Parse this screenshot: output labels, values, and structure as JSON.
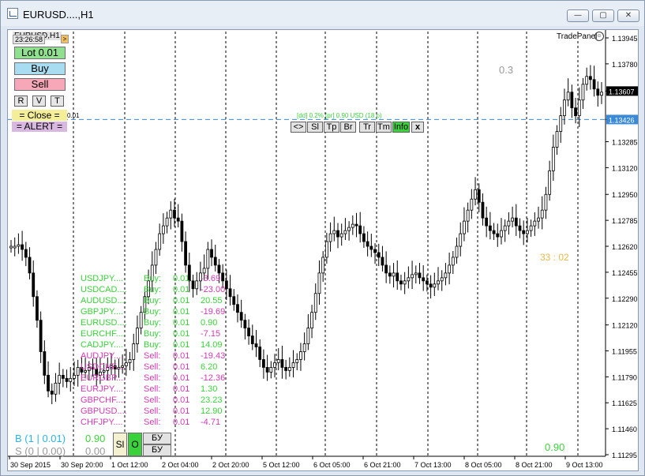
{
  "window": {
    "title": "EURUSD....,H1",
    "buttons": {
      "minimize": "—",
      "restore": "▢",
      "close": "✕"
    }
  },
  "chart_header": {
    "symbol_line": "EURUSD,H1",
    "time": "23:26:58",
    "arrow": ">",
    "tradepanel_label": "TradePanel",
    "smile_icon": "smile-icon"
  },
  "panel": {
    "lot": "Lot 0.01",
    "buy": "Buy",
    "sell": "Sell",
    "r": "R",
    "v": "V",
    "t": "T",
    "close": "= Close =",
    "close_suffix": "0.01",
    "alert": "= ALERT ="
  },
  "line_toolbar": {
    "info_text": "[dd] 0.2% [pr] 0.90 USD (18 p)",
    "buttons": [
      "<>",
      "Sl",
      "Tp",
      "Br",
      "Tr",
      "Tm",
      "Info",
      "x"
    ]
  },
  "chart_labels": {
    "top_value": "0.3",
    "timer": "33 : 02",
    "bottom_value": "0.90"
  },
  "positions": [
    {
      "symbol": "USDJPY....",
      "side": "Buy:",
      "lot": "0.01",
      "pnl": "-3.69"
    },
    {
      "symbol": "USDCAD....",
      "side": "Buy:",
      "lot": "0.01",
      "pnl": "-23.00"
    },
    {
      "symbol": "AUDUSD....",
      "side": "Buy:",
      "lot": "0.01",
      "pnl": "20.55"
    },
    {
      "symbol": "GBPJPY....",
      "side": "Buy:",
      "lot": "0.01",
      "pnl": "-19.69"
    },
    {
      "symbol": "EURUSD....",
      "side": "Buy:",
      "lot": "0.01",
      "pnl": "0.90"
    },
    {
      "symbol": "EURCHF....",
      "side": "Buy:",
      "lot": "0.01",
      "pnl": "-7.15"
    },
    {
      "symbol": "CADJPY....",
      "side": "Buy:",
      "lot": "0.01",
      "pnl": "14.09"
    },
    {
      "symbol": "AUDJPY....",
      "side": "Sell:",
      "lot": "0.01",
      "pnl": "-19.43"
    },
    {
      "symbol": "USDCHF....",
      "side": "Sell:",
      "lot": "0.01",
      "pnl": "6.20"
    },
    {
      "symbol": "EURGBP....",
      "side": "Sell:",
      "lot": "0.01",
      "pnl": "-12.36"
    },
    {
      "symbol": "EURJPY....",
      "side": "Sell:",
      "lot": "0.01",
      "pnl": "1.30"
    },
    {
      "symbol": "GBPCHF....",
      "side": "Sell:",
      "lot": "0.01",
      "pnl": "23.23"
    },
    {
      "symbol": "GBPUSD....",
      "side": "Sell:",
      "lot": "0.01",
      "pnl": "12.90"
    },
    {
      "symbol": "CHFJPY....",
      "side": "Sell:",
      "lot": "0.01",
      "pnl": "-4.71"
    }
  ],
  "summary": {
    "buy_line": "B (1 | 0.01)",
    "buy_value": "0.90",
    "sell_line": "S (0 | 0.00)",
    "sell_value": "0.00",
    "sl_btn": "Sl",
    "o_btn": "O",
    "bu_btn1": "БУ",
    "bu_btn2": "БУ"
  },
  "price_axis": {
    "ticks": [
      "1.13945",
      "1.13780",
      "1.13607",
      "1.13426",
      "1.13285",
      "1.13120",
      "1.12950",
      "1.12785",
      "1.12620",
      "1.12455",
      "1.12290",
      "1.12120",
      "1.11955",
      "1.11790",
      "1.11625",
      "1.11460",
      "1.11295"
    ],
    "current_price": "1.13607",
    "line_price": "1.13426"
  },
  "time_axis": {
    "ticks": [
      "30 Sep 2015",
      "30 Sep 20:00",
      "1 Oct 12:00",
      "2 Oct 04:00",
      "2 Oct 20:00",
      "5 Oct 12:00",
      "6 Oct 05:00",
      "6 Oct 21:00",
      "7 Oct 13:00",
      "8 Oct 05:00",
      "8 Oct 21:00",
      "9 Oct 13:00"
    ]
  },
  "chart_data": {
    "type": "line",
    "ylim": [
      1.1128,
      1.1401
    ],
    "xlabel": "",
    "ylabel": "",
    "series": [
      {
        "values": [
          1.1262,
          1.1262,
          1.1263,
          1.126,
          1.1255,
          1.1245,
          1.123,
          1.1215,
          1.1195,
          1.118,
          1.117,
          1.1168,
          1.1175,
          1.118,
          1.1178,
          1.1176,
          1.1178,
          1.118,
          1.1185,
          1.1182,
          1.1183,
          1.1185,
          1.1184,
          1.118,
          1.1182,
          1.1183,
          1.1185,
          1.1186,
          1.1184,
          1.1185,
          1.1186,
          1.1188,
          1.119,
          1.12,
          1.121,
          1.122,
          1.123,
          1.124,
          1.125,
          1.126,
          1.127,
          1.1275,
          1.128,
          1.1285,
          1.128,
          1.1278,
          1.1265,
          1.125,
          1.124,
          1.1235,
          1.124,
          1.1245,
          1.1248,
          1.126,
          1.1255,
          1.125,
          1.1245,
          1.124,
          1.1235,
          1.123,
          1.1225,
          1.122,
          1.1215,
          1.121,
          1.1205,
          1.12,
          1.1198,
          1.119,
          1.1185,
          1.1182,
          1.1185,
          1.1188,
          1.119,
          1.1185,
          1.1183,
          1.1185,
          1.1188,
          1.119,
          1.1195,
          1.12,
          1.121,
          1.122,
          1.1232,
          1.1245,
          1.1255,
          1.1265,
          1.127,
          1.1272,
          1.1268,
          1.127,
          1.1272,
          1.1274,
          1.1276,
          1.1275,
          1.127,
          1.1265,
          1.1262,
          1.126,
          1.1258,
          1.1255,
          1.125,
          1.1245,
          1.1243,
          1.1245,
          1.124,
          1.1238,
          1.124,
          1.1242,
          1.1244,
          1.1245,
          1.1242,
          1.124,
          1.1238,
          1.1236,
          1.1238,
          1.124,
          1.1242,
          1.1245,
          1.125,
          1.1255,
          1.1262,
          1.127,
          1.1278,
          1.1285,
          1.1292,
          1.1298,
          1.129,
          1.128,
          1.1275,
          1.1272,
          1.127,
          1.1268,
          1.1272,
          1.1275,
          1.1278,
          1.128,
          1.1275,
          1.1272,
          1.127,
          1.1272,
          1.1275,
          1.1278,
          1.128,
          1.1285,
          1.1295,
          1.131,
          1.1325,
          1.1335,
          1.1345,
          1.1355,
          1.136,
          1.135,
          1.1345,
          1.1355,
          1.1365,
          1.137,
          1.1368,
          1.1362,
          1.1358,
          1.136
        ]
      }
    ]
  }
}
